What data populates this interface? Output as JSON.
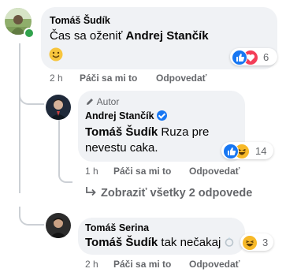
{
  "comments": [
    {
      "author": "Tomáš Šudík",
      "prefix": "Čas sa oženiť",
      "mention": "Andrej Stančík",
      "emoji": "slightly-smiling-face",
      "reactions": {
        "icons": [
          "like",
          "love"
        ],
        "count": "6"
      },
      "time": "2 h",
      "like_label": "Páči sa mi to",
      "reply_label": "Odpovedať"
    },
    {
      "author_badge": "Autor",
      "author": "Andrej Stančík",
      "mention": "Tomáš Šudík",
      "text": "Ruza pre nevestu caka.",
      "reactions": {
        "icons": [
          "like",
          "haha"
        ],
        "count": "14"
      },
      "time": "1 h",
      "like_label": "Páči sa mi to",
      "reply_label": "Odpovedať"
    },
    {
      "author": "Tomáš Serina",
      "mention": "Tomáš Šudík",
      "text": "tak nečakaj",
      "reactions": {
        "icons": [
          "haha"
        ],
        "count": "3"
      },
      "time": "2 h",
      "like_label": "Páči sa mi to",
      "reply_label": "Odpovedať"
    }
  ],
  "view_replies": "Zobraziť všetky 2 odpovede",
  "colors": {
    "bubble": "#f0f2f5",
    "secondary_text": "#65676b",
    "like_blue": "#1877f2",
    "love_red": "#f33e58",
    "haha_yellow": "#f7b928",
    "online_green": "#31a24c"
  }
}
